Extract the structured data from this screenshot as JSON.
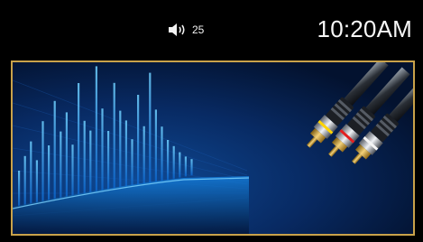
{
  "status_bar": {
    "volume_icon": "speaker-volume-icon",
    "volume_level": "25",
    "clock": "10:20AM"
  },
  "media_panel": {
    "image": "audio-equalizer-and-rca-cables",
    "frame_color": "#c9a24a",
    "equalizer_color": "#29a7ff",
    "cable_tip_colors": [
      "#ffd400",
      "#e32020",
      "#f4f4f4"
    ]
  }
}
